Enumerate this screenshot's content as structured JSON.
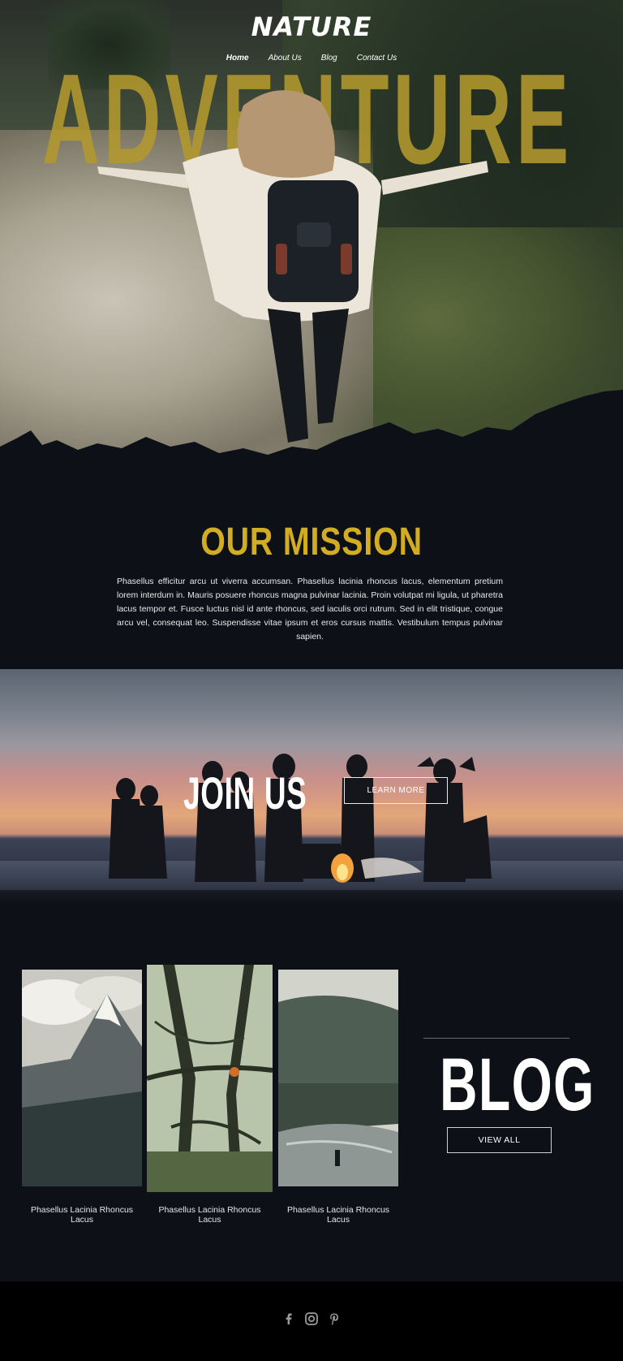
{
  "header": {
    "brand": "NATURE",
    "nav": [
      {
        "label": "Home",
        "active": true
      },
      {
        "label": "About Us",
        "active": false
      },
      {
        "label": "Blog",
        "active": false
      },
      {
        "label": "Contact Us",
        "active": false
      }
    ]
  },
  "hero": {
    "headline": "ADVENTURE"
  },
  "mission": {
    "title": "OUR MISSION",
    "text": "Phasellus efficitur arcu ut viverra accumsan. Phasellus lacinia rhoncus lacus, elementum pretium lorem interdum in. Mauris posuere rhoncus magna pulvinar lacinia. Proin volutpat mi ligula, ut pharetra lacus tempor et. Fusce luctus nisl id ante rhoncus, sed iaculis orci rutrum. Sed in elit tristique, congue arcu vel, consequat leo. Suspendisse vitae ipsum et eros cursus mattis. Vestibulum tempus pulvinar sapien."
  },
  "join": {
    "title": "JOIN US",
    "button_label": "LEARN MORE"
  },
  "blog": {
    "title": "BLOG",
    "button_label": "VIEW ALL",
    "posts": [
      {
        "caption": "Phasellus Lacinia Rhoncus Lacus",
        "image": "mountain-peak"
      },
      {
        "caption": "Phasellus Lacinia Rhoncus Lacus",
        "image": "forest-tree"
      },
      {
        "caption": "Phasellus Lacinia Rhoncus Lacus",
        "image": "river-valley"
      }
    ]
  },
  "footer": {
    "social": [
      "facebook-icon",
      "instagram-icon",
      "pinterest-icon"
    ]
  },
  "colors": {
    "accent_gold": "#d2ad22",
    "background_dark": "#0d1016",
    "footer_black": "#000000"
  }
}
